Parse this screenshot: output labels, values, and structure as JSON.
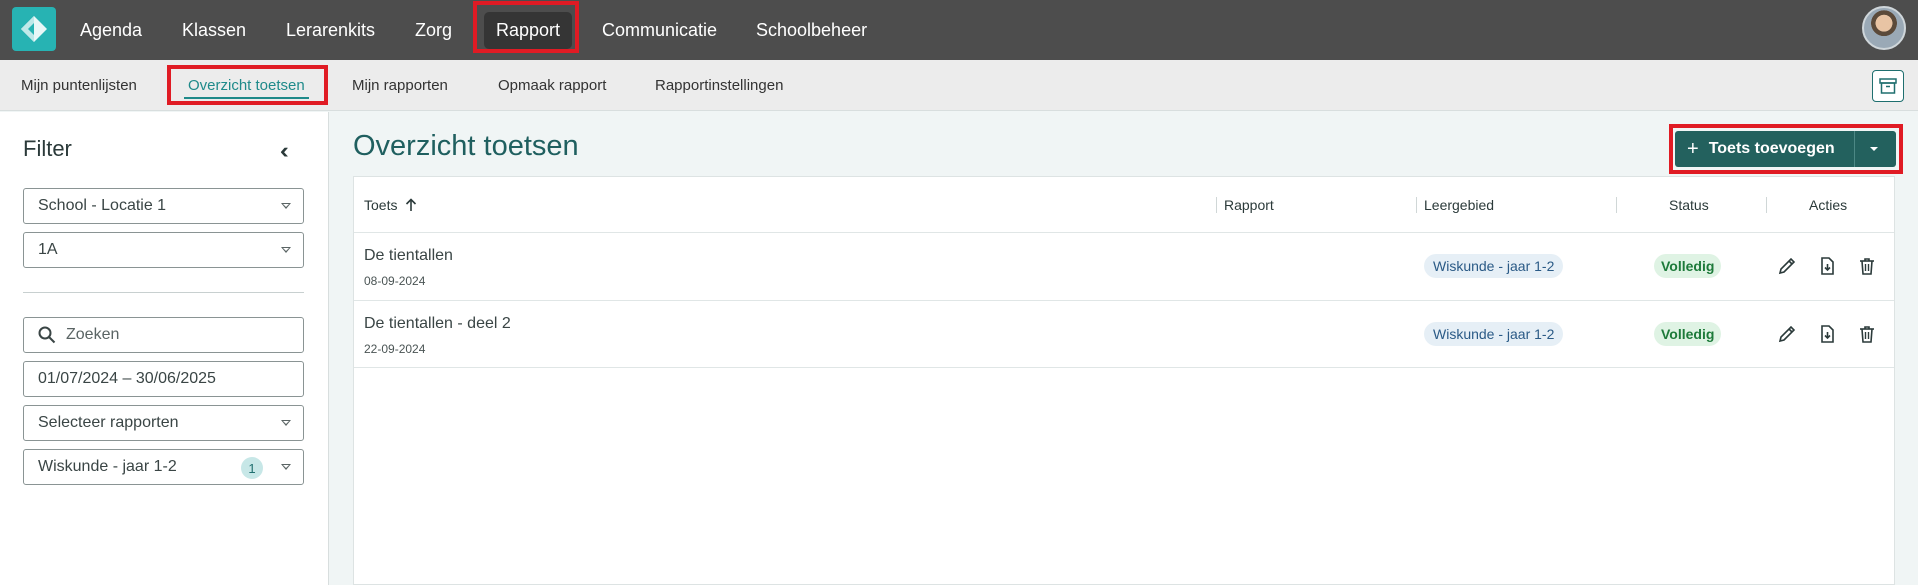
{
  "nav": {
    "items": [
      {
        "label": "Agenda"
      },
      {
        "label": "Klassen"
      },
      {
        "label": "Lerarenkits"
      },
      {
        "label": "Zorg"
      },
      {
        "label": "Rapport"
      },
      {
        "label": "Communicatie"
      },
      {
        "label": "Schoolbeheer"
      }
    ],
    "active": "Rapport"
  },
  "subnav": {
    "items": [
      {
        "label": "Mijn puntenlijsten"
      },
      {
        "label": "Overzicht toetsen"
      },
      {
        "label": "Mijn rapporten"
      },
      {
        "label": "Opmaak rapport"
      },
      {
        "label": "Rapportinstellingen"
      }
    ],
    "active": "Overzicht toetsen"
  },
  "filter": {
    "title": "Filter",
    "school": "School - Locatie 1",
    "klas": "1A",
    "search_placeholder": "Zoeken",
    "date_range": "01/07/2024 – 30/06/2025",
    "rapporten": "Selecteer rapporten",
    "leergebied": "Wiskunde - jaar 1-2",
    "leergebied_count": "1"
  },
  "main": {
    "title": "Overzicht toetsen",
    "add_button": "Toets toevoegen"
  },
  "table": {
    "headers": {
      "toets": "Toets",
      "rapport": "Rapport",
      "leergebied": "Leergebied",
      "status": "Status",
      "acties": "Acties"
    },
    "rows": [
      {
        "name": "De tientallen",
        "date": "08-09-2024",
        "rapport": "",
        "leergebied": "Wiskunde - jaar 1-2",
        "status": "Volledig"
      },
      {
        "name": "De tientallen - deel 2",
        "date": "22-09-2024",
        "rapport": "",
        "leergebied": "Wiskunde - jaar 1-2",
        "status": "Volledig"
      }
    ]
  },
  "colors": {
    "topbar": "#4d4d4d",
    "accent": "#1f8a8a",
    "primary_button": "#23615e",
    "highlight": "#e01b24",
    "status_ok": "#1d7a3a"
  },
  "icons": {
    "logo": "app-logo-icon",
    "search": "search-icon",
    "archive": "archive-icon",
    "collapse": "double-chevron-left-icon",
    "sort": "arrow-up-icon",
    "edit": "pencil-icon",
    "export": "file-download-icon",
    "delete": "trash-icon"
  }
}
